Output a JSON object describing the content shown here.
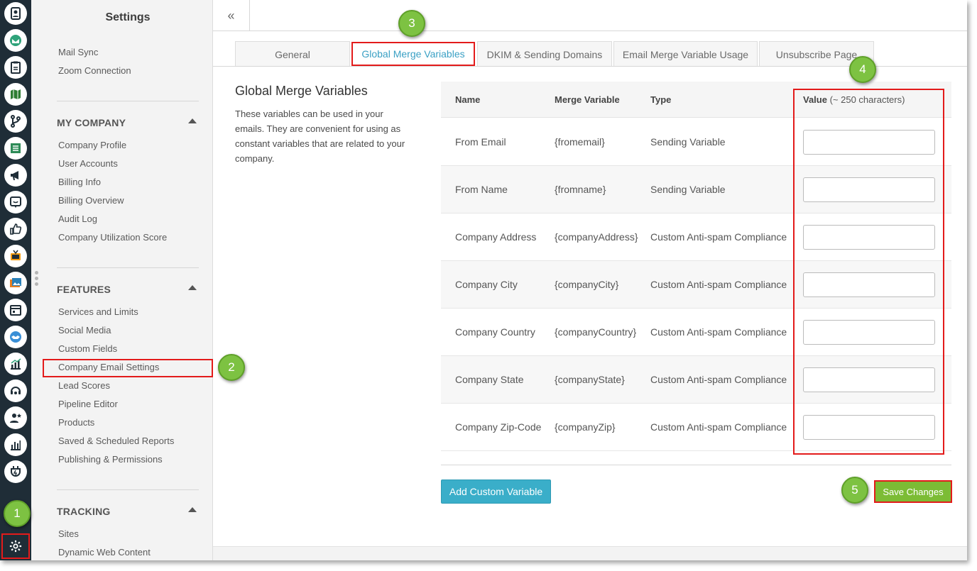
{
  "sidebar": {
    "title": "Settings",
    "top_links": [
      "Mail Sync",
      "Zoom Connection"
    ],
    "sections": [
      {
        "title": "MY COMPANY",
        "items": [
          "Company Profile",
          "User Accounts",
          "Billing Info",
          "Billing Overview",
          "Audit Log",
          "Company Utilization Score"
        ]
      },
      {
        "title": "FEATURES",
        "items": [
          "Services and Limits",
          "Social Media",
          "Custom Fields",
          "Company Email Settings",
          "Lead Scores",
          "Pipeline Editor",
          "Products",
          "Saved & Scheduled Reports",
          "Publishing & Permissions"
        ]
      },
      {
        "title": "TRACKING",
        "items": [
          "Sites",
          "Dynamic Web Content"
        ]
      }
    ],
    "selected_item": "Company Email Settings"
  },
  "topbar": {
    "collapse_glyph": "«"
  },
  "tabs": [
    {
      "label": "General",
      "active": false
    },
    {
      "label": "Global Merge Variables",
      "active": true
    },
    {
      "label": "DKIM & Sending Domains",
      "active": false
    },
    {
      "label": "Email Merge Variable Usage",
      "active": false
    },
    {
      "label": "Unsubscribe Page",
      "active": false
    }
  ],
  "main": {
    "title": "Global Merge Variables",
    "description": "These variables can be used in your emails. They are convenient for using as constant variables that are related to your company.",
    "table": {
      "headers": {
        "name": "Name",
        "merge_variable": "Merge Variable",
        "type": "Type",
        "value": "Value",
        "value_hint": "(~ 250 characters)"
      },
      "rows": [
        {
          "name": "From Email",
          "merge_variable": "{fromemail}",
          "type": "Sending Variable",
          "value": ""
        },
        {
          "name": "From Name",
          "merge_variable": "{fromname}",
          "type": "Sending Variable",
          "value": ""
        },
        {
          "name": "Company Address",
          "merge_variable": "{companyAddress}",
          "type": "Custom Anti-spam Compliance",
          "value": ""
        },
        {
          "name": "Company City",
          "merge_variable": "{companyCity}",
          "type": "Custom Anti-spam Compliance",
          "value": ""
        },
        {
          "name": "Company Country",
          "merge_variable": "{companyCountry}",
          "type": "Custom Anti-spam Compliance",
          "value": ""
        },
        {
          "name": "Company State",
          "merge_variable": "{companyState}",
          "type": "Custom Anti-spam Compliance",
          "value": ""
        },
        {
          "name": "Company Zip-Code",
          "merge_variable": "{companyZip}",
          "type": "Custom Anti-spam Compliance",
          "value": ""
        }
      ]
    },
    "add_button": "Add Custom Variable",
    "save_button": "Save Changes"
  },
  "callouts": [
    "1",
    "2",
    "3",
    "4",
    "5"
  ],
  "rail_icons": [
    "contacts-icon",
    "email-icon",
    "tasks-icon",
    "map-icon",
    "pipeline-icon",
    "lists-icon",
    "campaign-icon",
    "feedback-icon",
    "like-icon",
    "tv-icon",
    "media-icon",
    "calendar-icon",
    "handshake-icon",
    "analytics-icon",
    "support-icon",
    "user-star-icon",
    "reports-icon",
    "plugin-icon",
    "settings-gear-icon"
  ],
  "colors": {
    "rail_bg": "#1f2d37",
    "accent_blue": "#3aaec9",
    "save_green": "#7cbc35",
    "callout_green": "#7dc242",
    "highlight_red": "#e31b1b"
  }
}
